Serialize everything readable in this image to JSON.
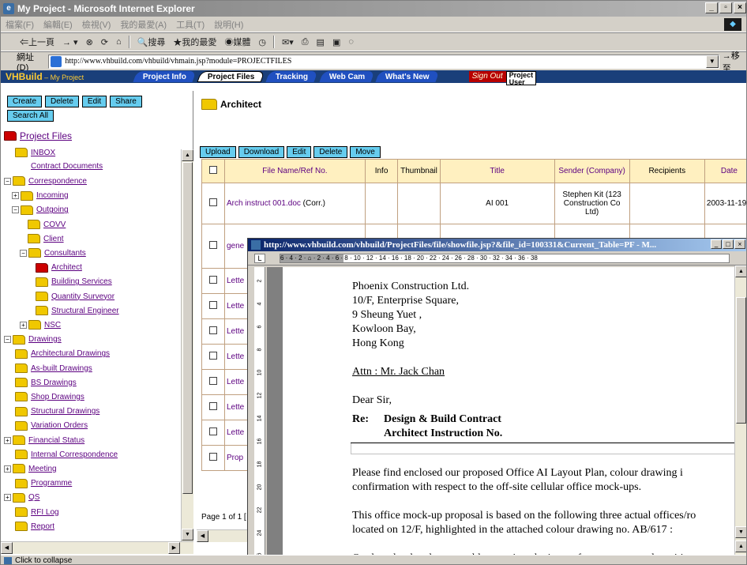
{
  "window": {
    "title": "My Project - Microsoft Internet Explorer"
  },
  "menu": [
    "檔案(F)",
    "編輯(E)",
    "檢視(V)",
    "我的最愛(A)",
    "工具(T)",
    "說明(H)"
  ],
  "toolbar": {
    "back": "⇐上一頁",
    "search": "搜尋",
    "favorites": "我的最愛",
    "media": "媒體"
  },
  "address": {
    "label": "網址(D)",
    "url": "http://www.vhbuild.com/vhbuild/vhmain.jsp?module=PROJECTFILES",
    "go": "移至"
  },
  "app": {
    "brand": "VHBuild",
    "brand_sub": " – My Project",
    "tabs": [
      "Project Info",
      "Project Files",
      "Tracking",
      "Web Cam",
      "What's New"
    ],
    "sign_out": "Sign Out",
    "project_user_top": "Project",
    "project_user_bottom": "User"
  },
  "left": {
    "buttons": [
      "Create",
      "Delete",
      "Edit",
      "Share"
    ],
    "search_all": "Search All",
    "tree": [
      {
        "label": "Project Files",
        "pm": "",
        "folder": "red",
        "root": true
      },
      {
        "label": "INBOX",
        "pm": "",
        "folder": "yellow"
      },
      {
        "label": "Contract Documents",
        "pm": "",
        "folder": "none"
      },
      {
        "label": "Correspondence",
        "pm": "−",
        "folder": "yellow"
      },
      {
        "label": "Incoming",
        "pm": "+",
        "folder": "yellow"
      },
      {
        "label": "Outgoing",
        "pm": "−",
        "folder": "yellow"
      },
      {
        "label": "COVV",
        "pm": "",
        "folder": "yellow"
      },
      {
        "label": "Client",
        "pm": "",
        "folder": "yellow"
      },
      {
        "label": "Consultants",
        "pm": "−",
        "folder": "yellow"
      },
      {
        "label": "Architect",
        "pm": "",
        "folder": "red"
      },
      {
        "label": "Building Services",
        "pm": "",
        "folder": "yellow"
      },
      {
        "label": "Quantity Surveyor",
        "pm": "",
        "folder": "yellow"
      },
      {
        "label": "Structural Engineer",
        "pm": "",
        "folder": "yellow"
      },
      {
        "label": "NSC",
        "pm": "+",
        "folder": "yellow"
      },
      {
        "label": "Drawings",
        "pm": "−",
        "folder": "yellow"
      },
      {
        "label": "Architectural Drawings",
        "pm": "",
        "folder": "yellow"
      },
      {
        "label": "As-built Drawings",
        "pm": "",
        "folder": "yellow"
      },
      {
        "label": "BS Drawings",
        "pm": "",
        "folder": "yellow"
      },
      {
        "label": "Shop Drawings",
        "pm": "",
        "folder": "yellow"
      },
      {
        "label": "Structural Drawings",
        "pm": "",
        "folder": "yellow"
      },
      {
        "label": "Variation Orders",
        "pm": "",
        "folder": "yellow"
      },
      {
        "label": "Financial Status",
        "pm": "+",
        "folder": "yellow"
      },
      {
        "label": "Internal Correspondence",
        "pm": "",
        "folder": "yellow"
      },
      {
        "label": "Meeting",
        "pm": "+",
        "folder": "yellow"
      },
      {
        "label": "Programme",
        "pm": "",
        "folder": "yellow"
      },
      {
        "label": "QS",
        "pm": "+",
        "folder": "yellow"
      },
      {
        "label": "RFI Log",
        "pm": "",
        "folder": "yellow"
      },
      {
        "label": "Report",
        "pm": "",
        "folder": "yellow"
      }
    ]
  },
  "right": {
    "heading": "Architect",
    "buttons": [
      "Upload",
      "Download",
      "Edit",
      "Delete",
      "Move"
    ],
    "columns": [
      "File Name/Ref No.",
      "Info",
      "Thumbnail",
      "Title",
      "Sender (Company)",
      "Recipients",
      "Date"
    ],
    "rows": [
      {
        "name": "Arch instruct 001.doc",
        "type": " (Corr.)",
        "title": "AI 001",
        "sender": "Stephen Kit (123 Construction Co Ltd)",
        "date": "2003-11-19"
      },
      {
        "name": "gene",
        "type": "",
        "title": "",
        "sender": "",
        "date": ""
      },
      {
        "name": "Lette",
        "type": "",
        "title": "",
        "sender": "",
        "date": ""
      },
      {
        "name": "Lette",
        "type": "",
        "title": "",
        "sender": "",
        "date": ""
      },
      {
        "name": "Lette",
        "type": "",
        "title": "",
        "sender": "",
        "date": ""
      },
      {
        "name": "Lette",
        "type": "",
        "title": "",
        "sender": "",
        "date": ""
      },
      {
        "name": "Lette",
        "type": "",
        "title": "",
        "sender": "",
        "date": ""
      },
      {
        "name": "Lette",
        "type": "",
        "title": "",
        "sender": "",
        "date": ""
      },
      {
        "name": "Lette",
        "type": "",
        "title": "",
        "sender": "",
        "date": ""
      },
      {
        "name": "Prop",
        "type": "",
        "title": "",
        "sender": "",
        "date": ""
      }
    ],
    "pager": "Page 1 of 1 [ 1"
  },
  "popup": {
    "title": "http://www.vhbuild.com/vhbuild/ProjectFiles/file/showfile.jsp?&file_id=100331&Current_Table=PF - M...",
    "ruler": "6 · 4 · 2 · ⌂ · 2 · 4 · 6 · 8 · 10 · 12 · 14 · 16 · 18 · 20 · 22 · 24 · 26 · 28 · 30 · 32 · 34 · 36 · 38",
    "vruler": [
      "2",
      "4",
      "6",
      "8",
      "10",
      "12",
      "14",
      "16",
      "18",
      "20",
      "22",
      "24",
      "26"
    ],
    "doc": {
      "addr1": "Phoenix Construction Ltd.",
      "addr2": "10/F, Enterprise Square,",
      "addr3": "9 Sheung Yuet ,",
      "addr4": "Kowloon Bay,",
      "addr5": "Hong Kong",
      "attn": "Attn : Mr. Jack Chan",
      "dear": "Dear Sir,",
      "re_label": "Re:",
      "re1": "Design & Build Contract",
      "re2": "Architect Instruction No.",
      "p1a": "Please find enclosed our proposed Office AI Layout Plan, colour drawing i",
      "p1b": "confirmation with respect to the off-site cellular office mock-ups.",
      "p2a": "This office mock-up proposal is based on the following three actual offices/ro",
      "p2b": "located on 12/F, highlighted in the attached colour drawing no. AB/617 :",
      "p3a": "On the other hand, we would appreciate the inputs from your named partition supp"
    }
  },
  "status": {
    "text": "Click to collapse"
  }
}
